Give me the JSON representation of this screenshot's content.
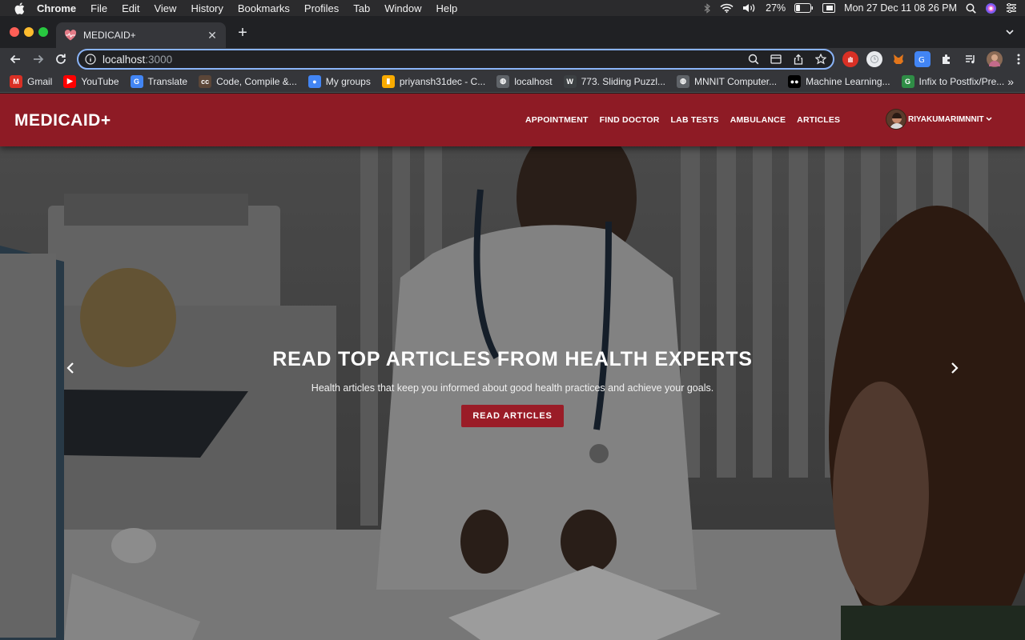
{
  "menubar": {
    "app": "Chrome",
    "items": [
      "File",
      "Edit",
      "View",
      "History",
      "Bookmarks",
      "Profiles",
      "Tab",
      "Window",
      "Help"
    ],
    "battery": "27%",
    "clock": "Mon 27 Dec  11 08 26 PM"
  },
  "tab": {
    "title": "MEDICAID+",
    "new_tab": "+"
  },
  "omnibox": {
    "host": "localhost",
    "port": ":3000"
  },
  "bookmarks": [
    {
      "label": "Gmail",
      "icon": "gmail-icon",
      "color": "#d93025",
      "glyph": "M"
    },
    {
      "label": "YouTube",
      "icon": "youtube-icon",
      "color": "#ff0000",
      "glyph": "▶"
    },
    {
      "label": "Translate",
      "icon": "translate-icon",
      "color": "#4285f4",
      "glyph": "G"
    },
    {
      "label": "Code, Compile &...",
      "icon": "codechef-icon",
      "color": "#5b4638",
      "glyph": "cc"
    },
    {
      "label": "My groups",
      "icon": "groups-icon",
      "color": "#4285f4",
      "glyph": "●"
    },
    {
      "label": "priyansh31dec - C...",
      "icon": "chart-icon",
      "color": "#f9ab00",
      "glyph": "▮"
    },
    {
      "label": "localhost",
      "icon": "globe-icon",
      "color": "#5f6368",
      "glyph": "◍"
    },
    {
      "label": "773. Sliding Puzzl...",
      "icon": "w-icon",
      "color": "#3c4043",
      "glyph": "W"
    },
    {
      "label": "MNNIT Computer...",
      "icon": "globe-icon",
      "color": "#5f6368",
      "glyph": "◍"
    },
    {
      "label": "Machine Learning...",
      "icon": "medium-icon",
      "color": "#000000",
      "glyph": "●●"
    },
    {
      "label": "Infix to Postfix/Pre...",
      "icon": "gfg-icon",
      "color": "#2f8d46",
      "glyph": "G"
    }
  ],
  "site": {
    "brand": "MEDICAID+",
    "nav": [
      "APPOINTMENT",
      "FIND DOCTOR",
      "LAB TESTS",
      "AMBULANCE",
      "ARTICLES"
    ],
    "user": "RIYAKUMARIMNNIT",
    "brand_color": "#8e1b25"
  },
  "hero": {
    "headline": "READ TOP ARTICLES FROM HEALTH EXPERTS",
    "subline": "Health articles that keep you informed about good health practices and achieve your goals.",
    "cta": "READ ARTICLES"
  }
}
